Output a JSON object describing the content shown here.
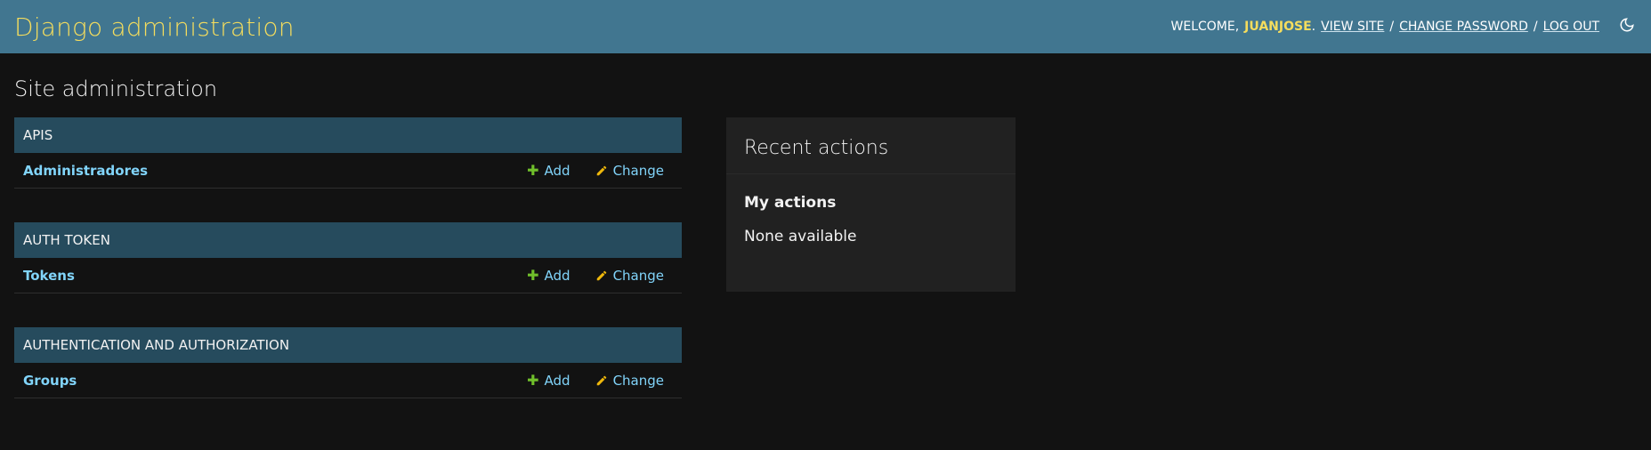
{
  "header": {
    "branding": "Django administration",
    "welcome_prefix": "WELCOME,",
    "username": "JUANJOSE",
    "username_suffix": ".",
    "view_site": "View site",
    "change_password": "Change password",
    "log_out": "Log out",
    "sep": "/",
    "theme_icon": "moon-icon"
  },
  "page": {
    "title": "Site administration"
  },
  "modules": [
    {
      "header": "APIS",
      "models": [
        {
          "name": "Administradores",
          "add": "Add",
          "change": "Change"
        }
      ]
    },
    {
      "header": "AUTH TOKEN",
      "models": [
        {
          "name": "Tokens",
          "add": "Add",
          "change": "Change"
        }
      ]
    },
    {
      "header": "AUTHENTICATION AND AUTHORIZATION",
      "models": [
        {
          "name": "Groups",
          "add": "Add",
          "change": "Change"
        }
      ]
    }
  ],
  "recent": {
    "title": "Recent actions",
    "subtitle": "My actions",
    "empty": "None available"
  },
  "colors": {
    "header_bg": "#417690",
    "branding": "#f5dd5d",
    "module_header_bg": "#264b5d",
    "link": "#81d4fa",
    "add_icon": "#70bf2b",
    "change_icon": "#efb80b"
  }
}
